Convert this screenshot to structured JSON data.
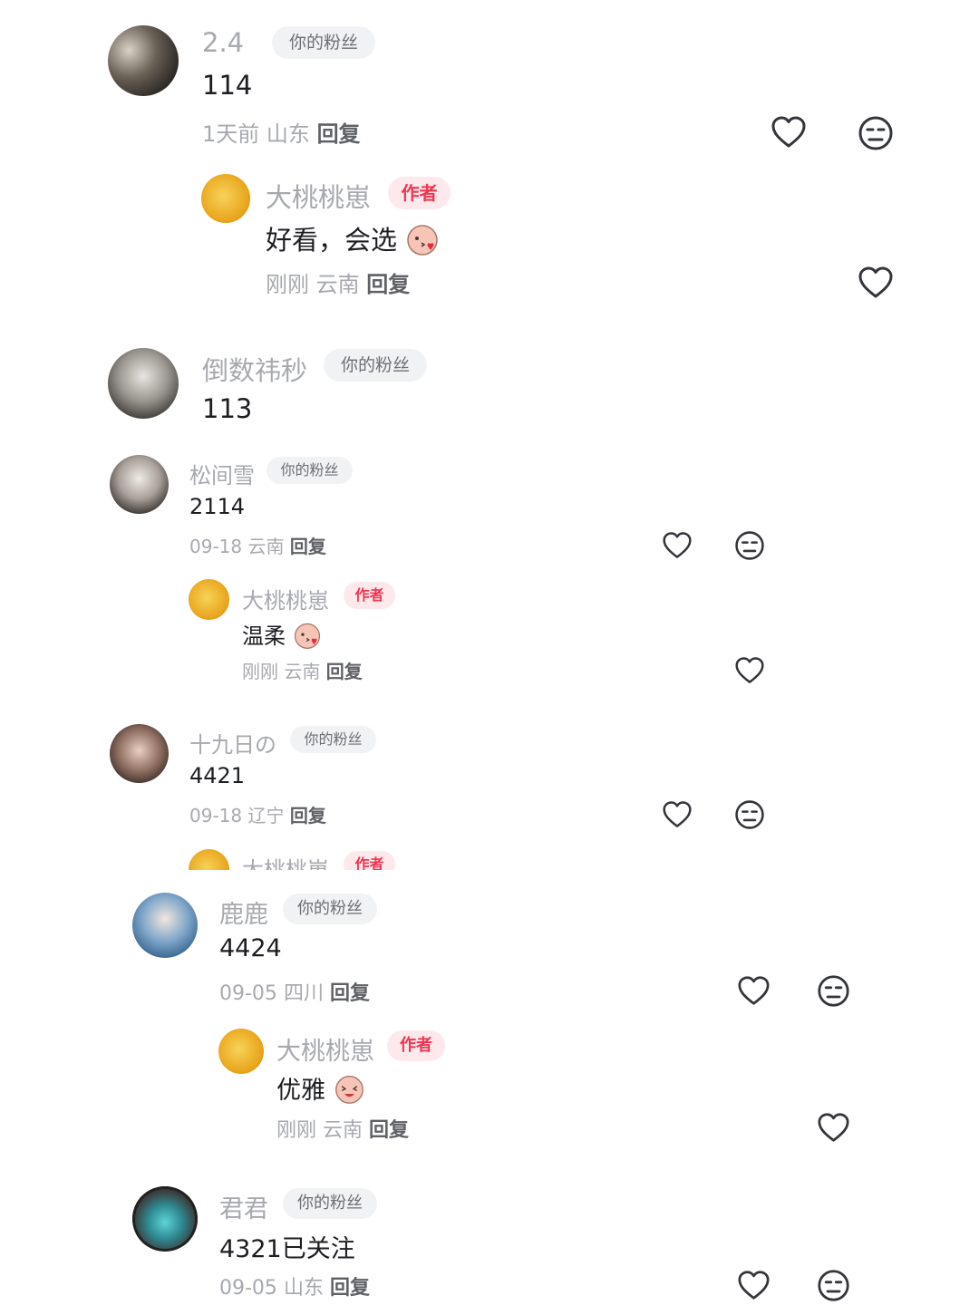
{
  "fan_badge": "你的粉丝",
  "author_badge": "作者",
  "reply_label": "回复",
  "comments": [
    {
      "name": "2.4",
      "text": "114",
      "time": "1天前",
      "location": "山东"
    },
    {
      "name": "大桃桃崽",
      "text": "好看，会选",
      "time": "刚刚",
      "location": "云南"
    },
    {
      "name": "倒数祎秒",
      "text": "113"
    },
    {
      "name": "松间雪",
      "text": "2114",
      "time": "09-18",
      "location": "云南"
    },
    {
      "name": "大桃桃崽",
      "text": "温柔",
      "time": "刚刚",
      "location": "云南"
    },
    {
      "name": "十九日の",
      "text": "4421",
      "time": "09-18",
      "location": "辽宁"
    },
    {
      "name": "大桃桃崽"
    },
    {
      "name": "鹿鹿",
      "text": "4424",
      "time": "09-05",
      "location": "四川"
    },
    {
      "name": "大桃桃崽",
      "text": "优雅",
      "time": "刚刚",
      "location": "云南"
    },
    {
      "name": "君君",
      "text": "4321已关注",
      "time": "09-05",
      "location": "山东"
    }
  ],
  "colors": {
    "author_badge_text": "#f0364f",
    "author_badge_bg": "#fde8ec",
    "name": "#a7a9ae",
    "content": "#1d1e22"
  },
  "icons": {
    "like": "heart-outline-icon",
    "dislike": "neutral-face-icon",
    "emoji": "peach-kiss-emoji"
  }
}
